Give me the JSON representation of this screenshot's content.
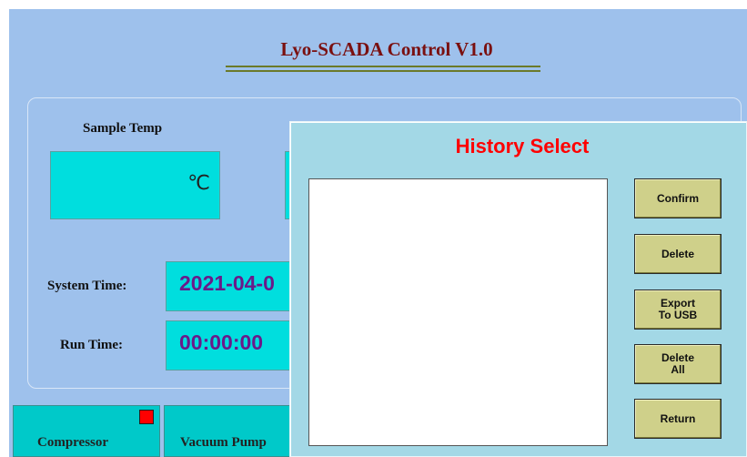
{
  "app": {
    "title": "Lyo-SCADA Control V1.0"
  },
  "panel": {
    "sample_temp_label": "Sample Temp",
    "temp_unit": "℃",
    "system_time_label": "System Time:",
    "system_time_value": "2021-04-0",
    "run_time_label": "Run Time:",
    "run_time_value": "00:00:00"
  },
  "bottom": {
    "compressor_label": "Compressor",
    "vacuum_pump_label": "Vacuum Pump",
    "compressor_status_color": "#ff0000"
  },
  "dialog": {
    "title": "History Select",
    "buttons": {
      "confirm": "Confirm",
      "delete": "Delete",
      "export": "Export\nTo USB",
      "delete_all": "Delete\nAll",
      "return": "Return"
    }
  }
}
